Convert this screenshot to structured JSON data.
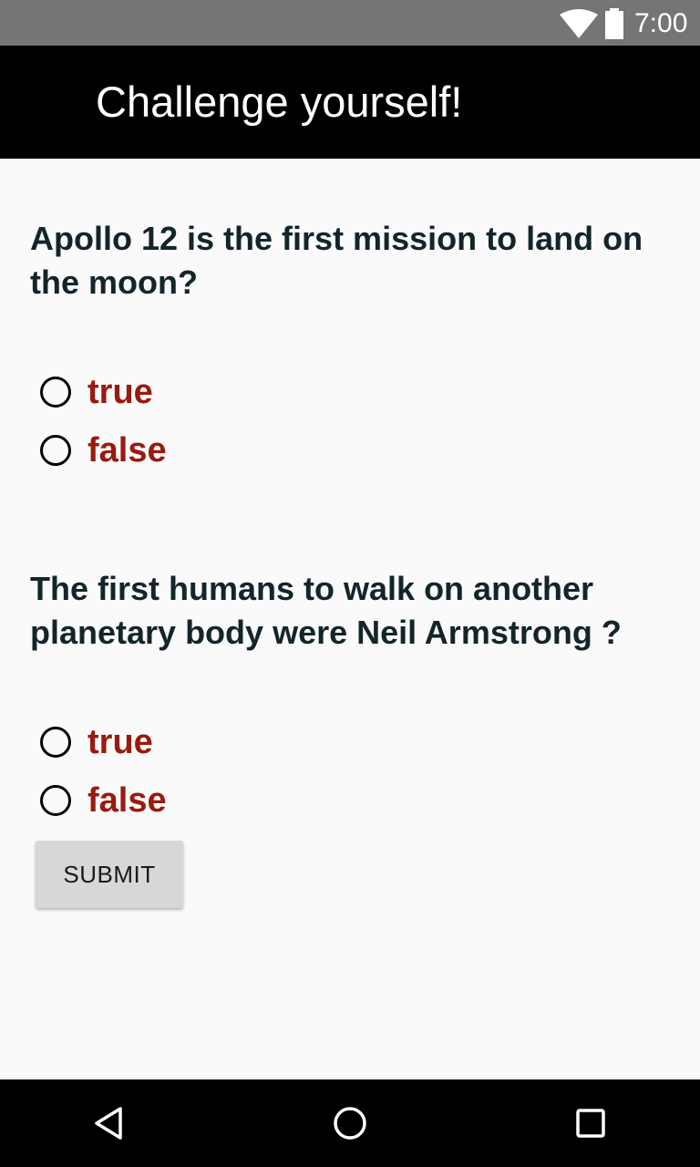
{
  "status_bar": {
    "time": "7:00",
    "icons": [
      "wifi-icon",
      "battery-icon"
    ]
  },
  "app_bar": {
    "title": "Challenge yourself!"
  },
  "questions": [
    {
      "text": "Apollo 12 is the first mission to land on the moon?",
      "options": [
        "true",
        "false"
      ]
    },
    {
      "text": "The first humans to walk on another planetary body were Neil Armstrong ?",
      "options": [
        "true",
        "false"
      ]
    }
  ],
  "submit_label": "SUBMIT",
  "nav_bar": {
    "icons": [
      "back-icon",
      "home-icon",
      "recents-icon"
    ]
  },
  "colors": {
    "status_bar": "#757575",
    "app_bar": "#000000",
    "background": "#fafafa",
    "question_text": "#13252a",
    "option_text": "#9a1a0f",
    "button": "#d6d7d7"
  }
}
